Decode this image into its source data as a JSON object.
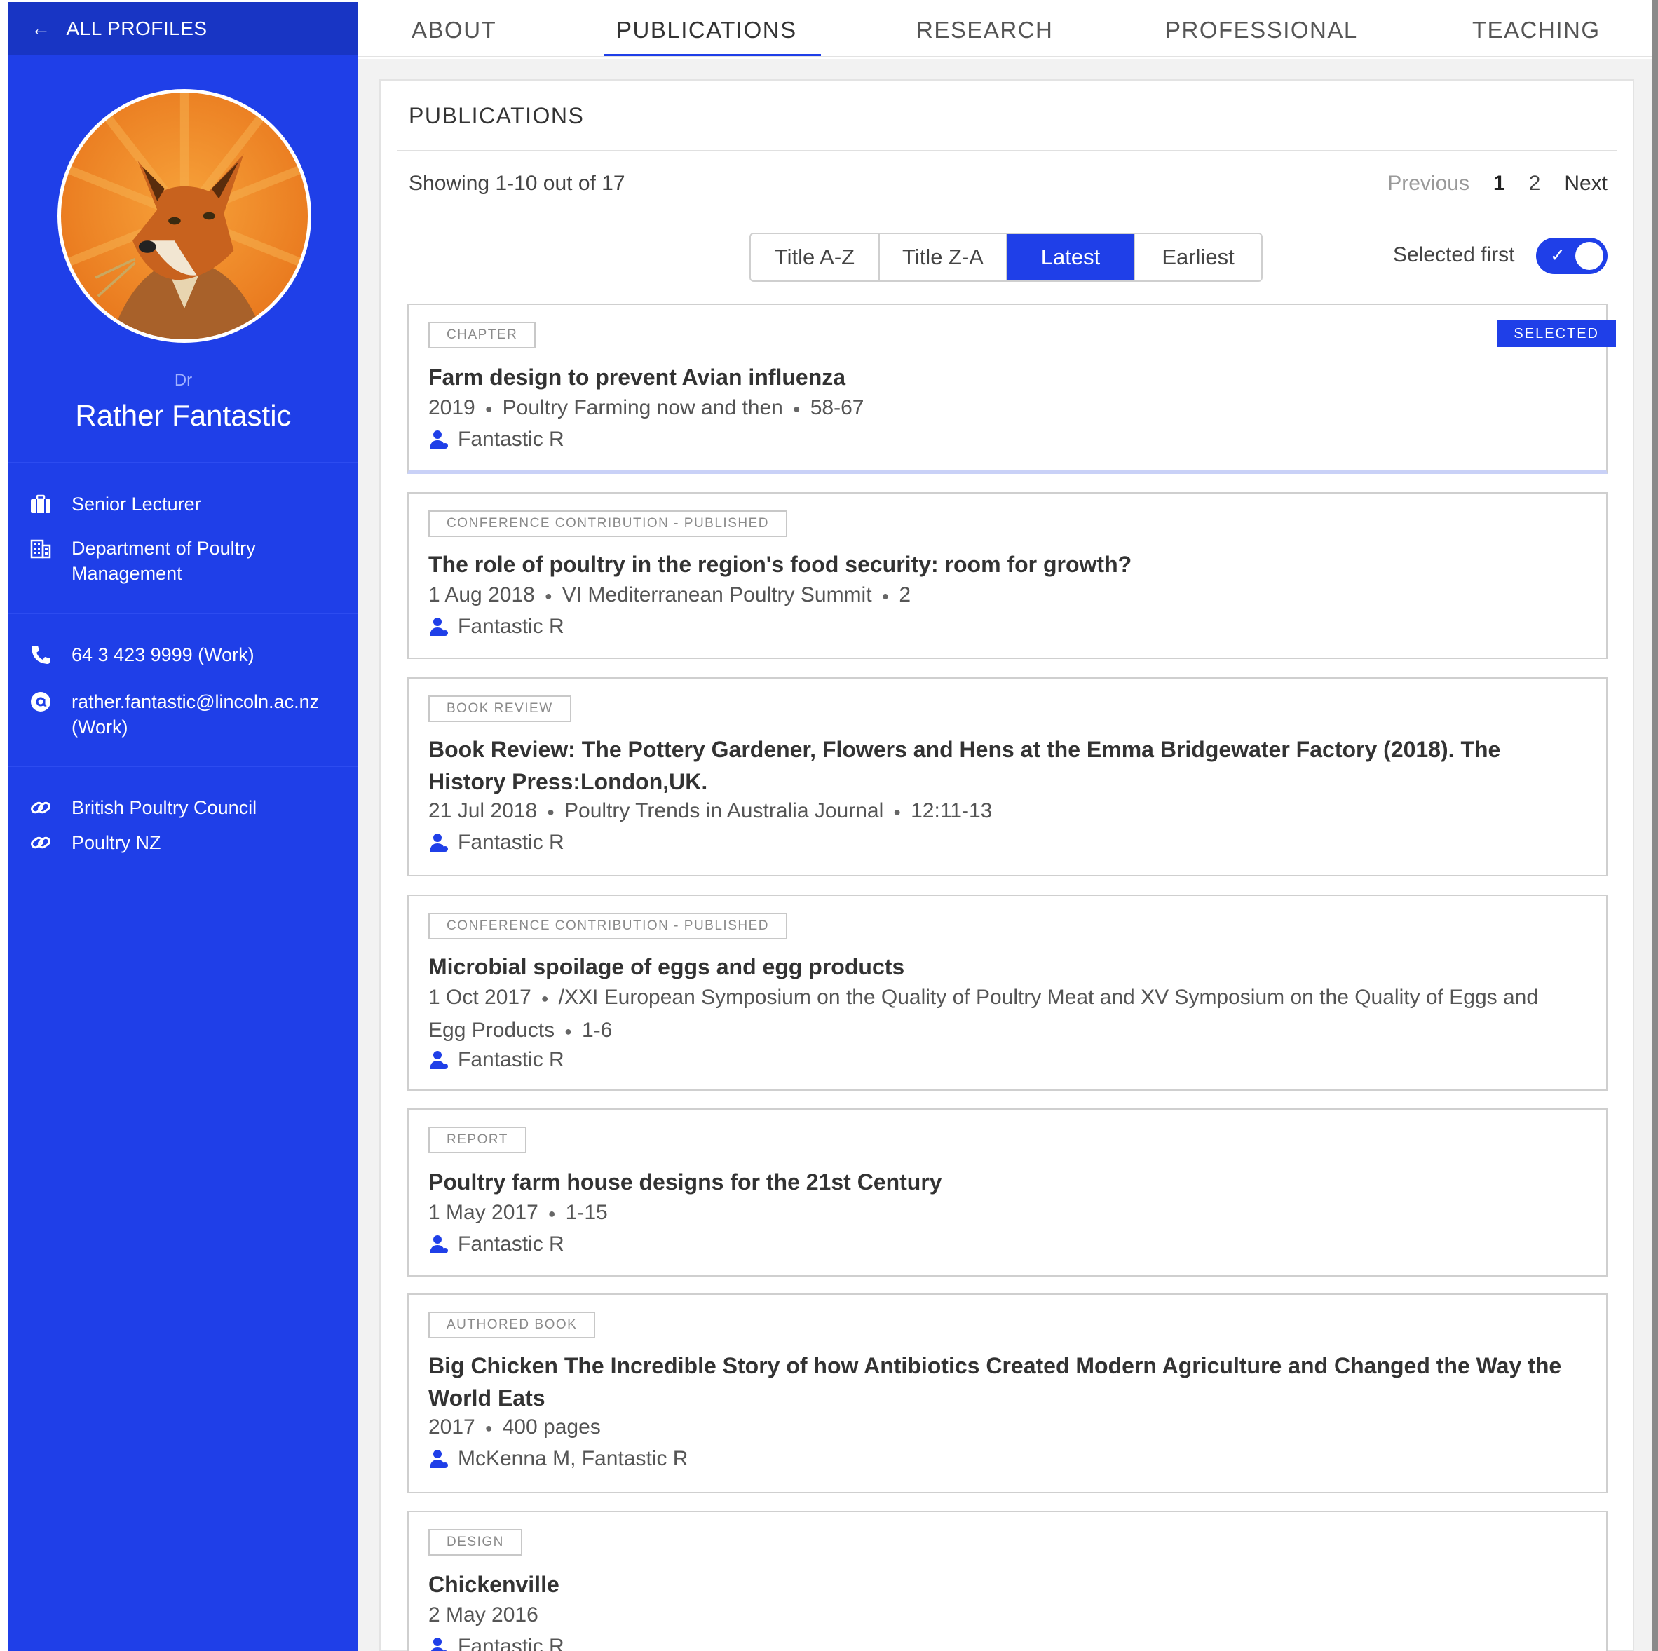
{
  "sidebar": {
    "back_label": "ALL PROFILES",
    "honorific": "Dr",
    "name": "Rather Fantastic",
    "position": "Senior Lecturer",
    "department": "Department of Poultry Management",
    "phone": "64 3 423 9999 (Work)",
    "email": "rather.fantastic@lincoln.ac.nz (Work)",
    "links": [
      "British Poultry Council",
      "Poultry NZ"
    ],
    "icons": {
      "back": "arrow-left-icon",
      "position": "briefcase-icon",
      "department": "building-icon",
      "phone": "phone-icon",
      "email": "at-sign-icon",
      "link": "link-icon"
    }
  },
  "nav": {
    "tabs": [
      "ABOUT",
      "PUBLICATIONS",
      "RESEARCH",
      "PROFESSIONAL",
      "TEACHING"
    ],
    "active_tab": "PUBLICATIONS"
  },
  "publications": {
    "heading": "PUBLICATIONS",
    "showing": "Showing 1-10 out of 17",
    "pager": {
      "previous": "Previous",
      "pages": [
        "1",
        "2"
      ],
      "current": "1",
      "next": "Next"
    },
    "sort_options": [
      "Title A-Z",
      "Title Z-A",
      "Latest",
      "Earliest"
    ],
    "active_sort": "Latest",
    "selected_first_label": "Selected first",
    "selected_first_on": true,
    "selected_label": "SELECTED",
    "items": [
      {
        "type": "CHAPTER",
        "title": "Farm design to prevent Avian influenza",
        "date": "2019",
        "venue": "Poultry Farming now and then",
        "pages": "58-67",
        "authors": "Fantastic R",
        "selected": true
      },
      {
        "type": "CONFERENCE CONTRIBUTION - PUBLISHED",
        "title": "The role of poultry in the region's food security: room for growth?",
        "date": "1 Aug 2018",
        "venue": "VI Mediterranean Poultry Summit",
        "pages": "2",
        "authors": "Fantastic R",
        "selected": false
      },
      {
        "type": "BOOK REVIEW",
        "title": "Book Review: The Pottery Gardener, Flowers and Hens at the Emma Bridgewater Factory (2018). The History Press:London,UK.",
        "date": "21 Jul 2018",
        "venue": "Poultry Trends in Australia Journal",
        "pages": "12:11-13",
        "authors": "Fantastic R",
        "selected": false
      },
      {
        "type": "CONFERENCE CONTRIBUTION - PUBLISHED",
        "title": "Microbial spoilage of eggs and egg products",
        "date": "1 Oct 2017",
        "venue": "/XXI European Symposium on the Quality of Poultry Meat and XV Symposium on the Quality of Eggs and Egg Products",
        "pages": "1-6",
        "authors": "Fantastic R",
        "selected": false
      },
      {
        "type": "REPORT",
        "title": "Poultry farm house designs for the 21st Century",
        "date": "1 May 2017",
        "venue": "",
        "pages": "1-15",
        "authors": "Fantastic R",
        "selected": false
      },
      {
        "type": "AUTHORED BOOK",
        "title": "Big Chicken The Incredible Story of how Antibiotics Created Modern Agriculture and Changed the Way the World Eats",
        "date": "2017",
        "venue": "",
        "pages": "400 pages",
        "authors": "McKenna M, Fantastic R",
        "selected": false
      },
      {
        "type": "DESIGN",
        "title": "Chickenville",
        "date": "2 May 2016",
        "venue": "",
        "pages": "",
        "authors": "Fantastic R",
        "selected": false
      }
    ]
  },
  "colors": {
    "brand_blue": "#1f3fe8",
    "sidebar_header": "#1835c4",
    "content_bg": "#f2f2f2"
  }
}
